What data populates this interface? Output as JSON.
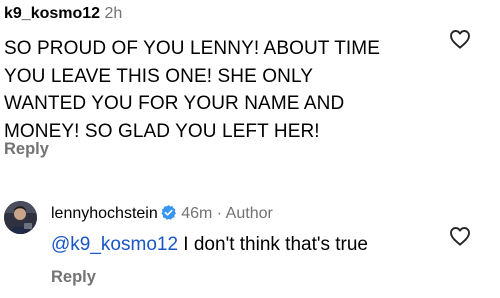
{
  "comments": [
    {
      "username": "k9_kosmo12",
      "time": "2h",
      "text": "SO PROUD OF YOU LENNY! ABOUT TIME YOU LEAVE THIS ONE! SHE ONLY WANTED YOU FOR YOUR NAME AND MONEY! SO GLAD YOU LEFT HER!",
      "lines": [
        "SO PROUD OF YOU LENNY! ABOUT TIME",
        "YOU LEAVE THIS ONE! SHE ONLY",
        "WANTED YOU FOR YOUR NAME AND",
        "MONEY! SO GLAD YOU LEFT HER!"
      ],
      "reply_label": "Reply",
      "like_icon": "heart-outline-icon"
    },
    {
      "username": "lennyhochstein",
      "verified": true,
      "verified_icon": "verified-badge-icon",
      "time": "46m",
      "separator": "·",
      "role": "Author",
      "mention": "@k9_kosmo12",
      "text": " I don't think that's true",
      "reply_label": "Reply",
      "like_icon": "heart-outline-icon",
      "avatar_icon": "profile-avatar"
    }
  ],
  "colors": {
    "mention": "#1a56c8",
    "secondary_text": "#737373",
    "verified": "#3797f0"
  }
}
